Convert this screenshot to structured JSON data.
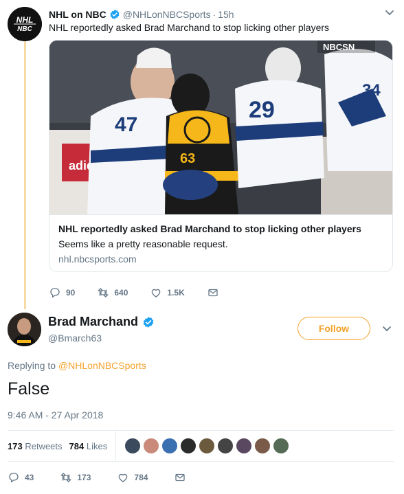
{
  "parent_tweet": {
    "author_name": "NHL on NBC",
    "author_handle": "@NHLonNBCSports",
    "separator": "·",
    "time": "15h",
    "avatar_text": "NHL NBC",
    "text": "NHL reportedly asked Brad Marchand to stop licking other players",
    "card": {
      "image_labels": {
        "network_watermark": "NBCSN",
        "ad_board": "adidas",
        "jersey_numbers": [
          "47",
          "63",
          "29",
          "34"
        ]
      },
      "title": "NHL reportedly asked Brad Marchand to stop licking other players",
      "description": "Seems like a pretty reasonable request.",
      "domain": "nhl.nbcsports.com"
    },
    "actions": {
      "replies": "90",
      "retweets": "640",
      "likes": "1.5K"
    },
    "icons": [
      "verified-badge-icon",
      "chevron-down-icon",
      "reply-icon",
      "retweet-icon",
      "like-icon",
      "message-icon"
    ]
  },
  "main_tweet": {
    "author_name": "Brad Marchand",
    "author_handle": "@Bmarch63",
    "follow_label": "Follow",
    "replying_prefix": "Replying to",
    "replying_to": "@NHLonNBCSports",
    "text": "False",
    "timestamp": "9:46 AM - 27 Apr 2018",
    "stats": {
      "retweets_count": "173",
      "retweets_label": "Retweets",
      "likes_count": "784",
      "likes_label": "Likes"
    },
    "liker_avatars": [
      "#3b4a5c",
      "#c98a7a",
      "#3a6fb0",
      "#2b2b2b",
      "#6b5a3e",
      "#444444",
      "#5a4860",
      "#7a5a48",
      "#556b55"
    ],
    "actions": {
      "replies": "43",
      "retweets": "173",
      "likes": "784"
    }
  },
  "colors": {
    "accent": "#f4a22b",
    "verified": "#1da1f2",
    "secondary_text": "#657786",
    "thread_line": "#f7d9a4"
  }
}
